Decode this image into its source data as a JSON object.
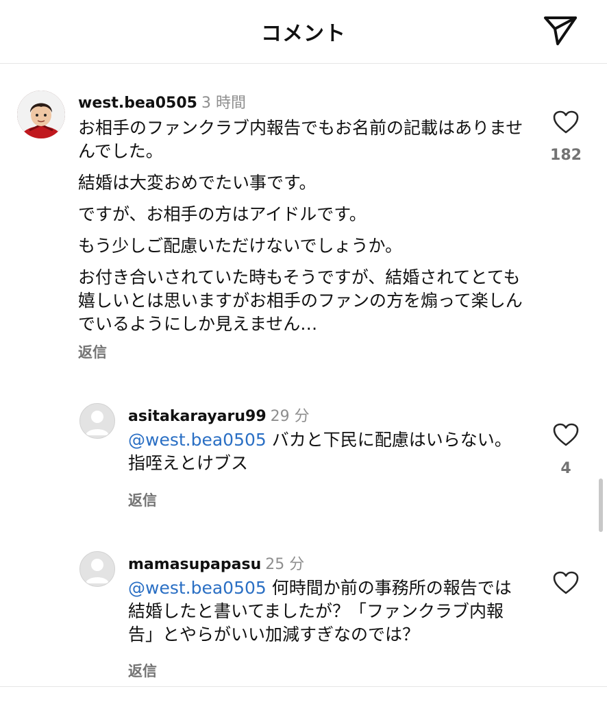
{
  "header": {
    "title": "コメント",
    "share_icon": "paper-plane-icon"
  },
  "comments": [
    {
      "username": "west.bea0505",
      "time": "3 時間",
      "paragraphs": [
        "お相手のファンクラブ内報告でもお名前の記載はありませんでした。",
        "結婚は大変おめでたい事です。",
        "ですが、お相手の方はアイドルです。",
        "もう少しご配慮いただけないでしょうか。",
        "お付き合いされていた時もそうですが、結婚されてとても嬉しいとは思いますがお相手のファンの方を煽って楽しんでいるようにしか見えません…"
      ],
      "reply_label": "返信",
      "like_count": "182"
    },
    {
      "username": "asitakarayaru99",
      "time": "29 分",
      "mention": "@west.bea0505",
      "text": " バカと下民に配慮はいらない。指咥えとけブス",
      "reply_label": "返信",
      "like_count": "4"
    },
    {
      "username": "mamasupapasu",
      "time": "25 分",
      "mention": "@west.bea0505",
      "text": " 何時間か前の事務所の報告では結婚したと書いてましたが？「ファンクラブ内報告」とやらがいい加減すぎなのでは？",
      "reply_label": "返信"
    }
  ],
  "colors": {
    "mention": "#2a6fc4",
    "muted": "#8e8e8e",
    "heart_stroke": "#262626"
  }
}
